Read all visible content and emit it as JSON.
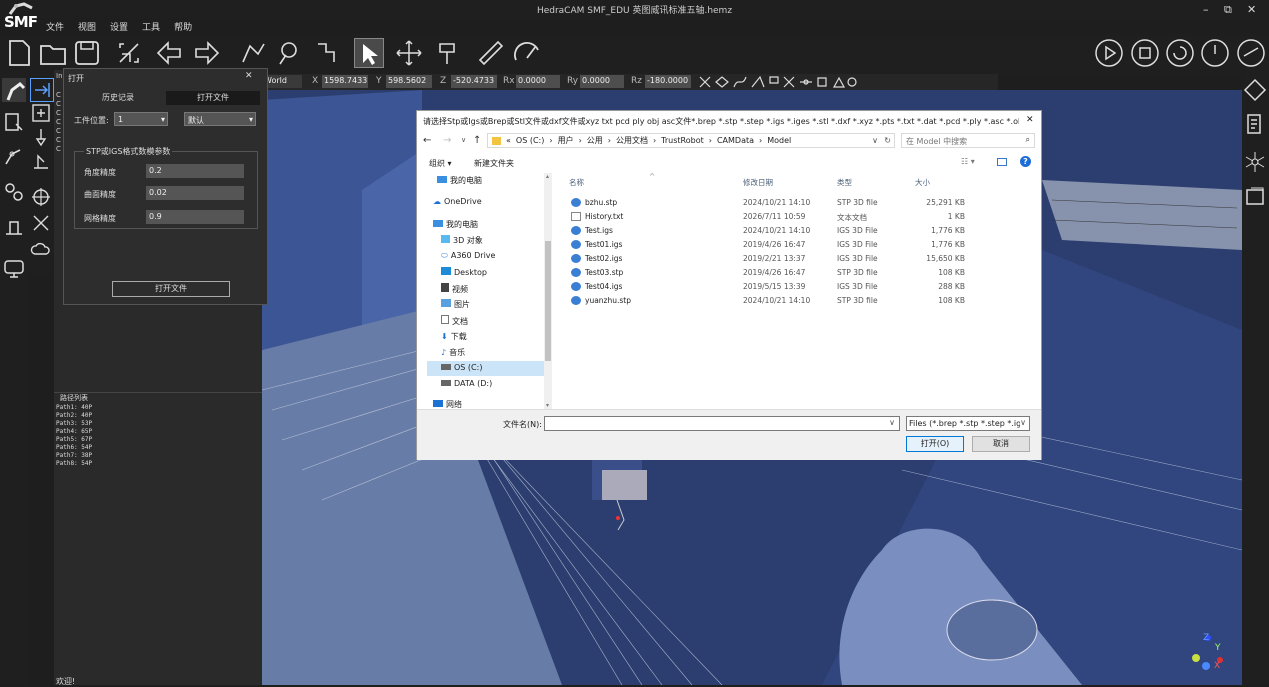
{
  "app": {
    "title": "HedraCAM SMF_EDU  英图威讯标准五轴.hemz",
    "logo": "SMF"
  },
  "menu": [
    "文件",
    "视图",
    "设置",
    "工具",
    "帮助"
  ],
  "window_controls": {
    "minimize": "–",
    "restore": "⧉",
    "close": "✕"
  },
  "coords": {
    "frame": "World",
    "x_label": "X",
    "x": "1598.7433",
    "y_label": "Y",
    "y": "598.5602",
    "z_label": "Z",
    "z": "-520.4733",
    "rx_label": "Rx",
    "rx": "0.0000",
    "ry_label": "Ry",
    "ry": "0.0000",
    "rz_label": "Rz",
    "rz": "-180.0000"
  },
  "open_panel": {
    "title": "打开",
    "close": "✕",
    "tabs": [
      "历史记录",
      "打开文件"
    ],
    "workpiece_label": "工件位置:",
    "workpiece_value": "1",
    "workpiece_mode": "默认",
    "group_title": "STP或IGS格式数模参数",
    "params": [
      {
        "label": "角度精度",
        "value": "0.2"
      },
      {
        "label": "曲面精度",
        "value": "0.02"
      },
      {
        "label": "网格精度",
        "value": "0.9"
      }
    ],
    "open_button": "打开文件"
  },
  "left_panel_letters": [
    "In",
    "C",
    "C",
    "C",
    "C",
    "C",
    "C",
    "C"
  ],
  "path_list": {
    "title": "路径列表",
    "items": [
      "Path1: 40P",
      "Path2: 40P",
      "Path3: 53P",
      "Path4: 65P",
      "Path5: 67P",
      "Path6: 54P",
      "Path7: 38P",
      "Path8: 54P"
    ]
  },
  "status": "欢迎!",
  "file_dialog": {
    "title": "请选择Stp或Igs或Brep或Stl文件或dxf文件或xyz txt pcd ply obj asc文件*.brep *.stp *.step *.igs *.iges *.stl *.dxf *.xyz *.pts *.txt *.dat *.pcd *.ply *.asc *.obj",
    "close": "✕",
    "breadcrumb": [
      "«",
      "OS (C:)",
      "用户",
      "公用",
      "公用文档",
      "TrustRobot",
      "CAMData",
      "Model"
    ],
    "search_placeholder": "在 Model 中搜索",
    "organize": "组织 ▾",
    "new_folder": "新建文件夹",
    "nav_items": [
      "我的电脑",
      "OneDrive",
      "我的电脑",
      "3D 对象",
      "A360 Drive",
      "Desktop",
      "视频",
      "图片",
      "文档",
      "下载",
      "音乐",
      "OS (C:)",
      "DATA (D:)",
      "网络"
    ],
    "columns": [
      "名称",
      "修改日期",
      "类型",
      "大小"
    ],
    "files": [
      {
        "name": "bzhu.stp",
        "date": "2024/10/21 14:10",
        "type": "STP 3D file",
        "size": "25,291 KB",
        "icon": "3d-file-icon"
      },
      {
        "name": "History.txt",
        "date": "2026/7/11 10:59",
        "type": "文本文档",
        "size": "1 KB",
        "icon": "text-file-icon"
      },
      {
        "name": "Test.igs",
        "date": "2024/10/21 14:10",
        "type": "IGS 3D File",
        "size": "1,776 KB",
        "icon": "3d-file-icon"
      },
      {
        "name": "Test01.igs",
        "date": "2019/4/26 16:47",
        "type": "IGS 3D File",
        "size": "1,776 KB",
        "icon": "3d-file-icon"
      },
      {
        "name": "Test02.igs",
        "date": "2019/2/21 13:37",
        "type": "IGS 3D File",
        "size": "15,650 KB",
        "icon": "3d-file-icon"
      },
      {
        "name": "Test03.stp",
        "date": "2019/4/26 16:47",
        "type": "STP 3D file",
        "size": "108 KB",
        "icon": "3d-file-icon"
      },
      {
        "name": "Test04.igs",
        "date": "2019/5/15 13:39",
        "type": "IGS 3D File",
        "size": "288 KB",
        "icon": "3d-file-icon"
      },
      {
        "name": "yuanzhu.stp",
        "date": "2024/10/21 14:10",
        "type": "STP 3D file",
        "size": "108 KB",
        "icon": "3d-file-icon"
      }
    ],
    "filename_label": "文件名(N):",
    "filename_value": "",
    "filter": "Files (*.brep *.stp *.step *.igs",
    "open": "打开(O)",
    "cancel": "取消"
  },
  "colors": {
    "viewport": "#2b3d6f",
    "accent": "#0078d7"
  }
}
